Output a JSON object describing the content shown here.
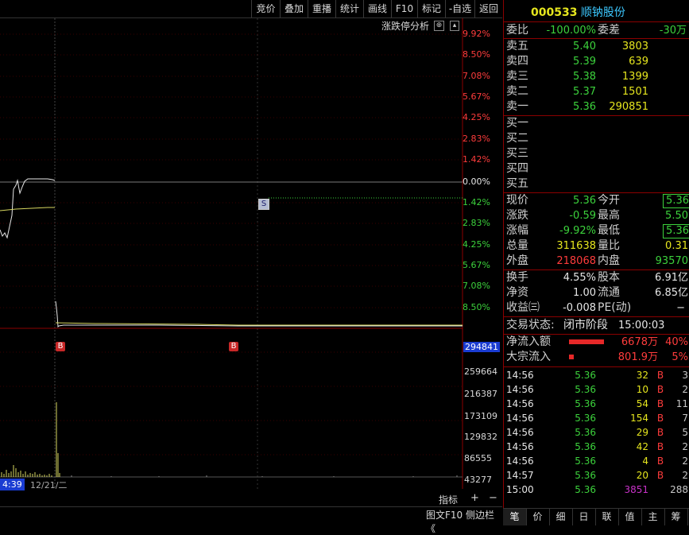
{
  "toolbar": {
    "items": [
      "竞价",
      "叠加",
      "重播",
      "统计",
      "画线",
      "F10",
      "标记",
      "-自选",
      "返回"
    ]
  },
  "chart": {
    "panel_title": "涨跌停分析",
    "pct_labels_up": [
      "9.92%",
      "8.50%",
      "7.08%",
      "5.67%",
      "4.25%",
      "2.83%",
      "1.42%"
    ],
    "pct_zero": "0.00%",
    "pct_labels_down": [
      "1.42%",
      "2.83%",
      "4.25%",
      "5.67%",
      "7.08%",
      "8.50%"
    ],
    "vol_labels": [
      "294841",
      "259664",
      "216387",
      "173109",
      "129832",
      "86555",
      "43277"
    ],
    "time_left": "4:39",
    "date_label": "12/21/二",
    "markers": {
      "s": "S",
      "b": "B"
    },
    "bottom_buttons": {
      "indicator": "指标",
      "plus": "+",
      "minus": "−"
    },
    "footer_right": "图文F10 侧边栏 《"
  },
  "stock": {
    "code": "000533",
    "name": "顺钠股份"
  },
  "weibi": {
    "label": "委比",
    "value": "-100.00%",
    "wc_label": "委差",
    "wc_value": "-30万"
  },
  "sell": [
    {
      "label": "卖五",
      "price": "5.40",
      "vol": "3803"
    },
    {
      "label": "卖四",
      "price": "5.39",
      "vol": "639"
    },
    {
      "label": "卖三",
      "price": "5.38",
      "vol": "1399"
    },
    {
      "label": "卖二",
      "price": "5.37",
      "vol": "1501"
    },
    {
      "label": "卖一",
      "price": "5.36",
      "vol": "290851"
    }
  ],
  "buy": [
    "买一",
    "买二",
    "买三",
    "买四",
    "买五"
  ],
  "quote": [
    {
      "l1": "现价",
      "v1": "5.36",
      "l2": "今开",
      "v2": "5.36"
    },
    {
      "l1": "涨跌",
      "v1": "-0.59",
      "l2": "最高",
      "v2": "5.50"
    },
    {
      "l1": "涨幅",
      "v1": "-9.92%",
      "l2": "最低",
      "v2": "5.36"
    },
    {
      "l1": "总量",
      "v1": "311638",
      "l2": "量比",
      "v2": "0.31"
    },
    {
      "l1": "外盘",
      "v1": "218068",
      "l2": "内盘",
      "v2": "93570"
    }
  ],
  "stats": [
    {
      "l1": "换手",
      "v1": "4.55%",
      "l2": "股本",
      "v2": "6.91亿"
    },
    {
      "l1": "净资",
      "v1": "1.00",
      "l2": "流通",
      "v2": "6.85亿"
    },
    {
      "l1": "收益㈢",
      "v1": "-0.008",
      "l2": "PE(动)",
      "v2": "−"
    }
  ],
  "trade_status": {
    "label": "交易状态:",
    "value": "闭市阶段",
    "time": "15:00:03"
  },
  "flows": [
    {
      "label": "净流入额",
      "value": "6678万",
      "pct": "40%",
      "bar_fraction": 0.4
    },
    {
      "label": "大宗流入",
      "value": "801.9万",
      "pct": "5%",
      "bar_fraction": 0.05
    }
  ],
  "ticks": [
    {
      "time": "14:56",
      "price": "5.36",
      "vol": "32",
      "bs": "B",
      "n": "3"
    },
    {
      "time": "14:56",
      "price": "5.36",
      "vol": "10",
      "bs": "B",
      "n": "2"
    },
    {
      "time": "14:56",
      "price": "5.36",
      "vol": "54",
      "bs": "B",
      "n": "11"
    },
    {
      "time": "14:56",
      "price": "5.36",
      "vol": "154",
      "bs": "B",
      "n": "7"
    },
    {
      "time": "14:56",
      "price": "5.36",
      "vol": "29",
      "bs": "B",
      "n": "5"
    },
    {
      "time": "14:56",
      "price": "5.36",
      "vol": "42",
      "bs": "B",
      "n": "2"
    },
    {
      "time": "14:56",
      "price": "5.36",
      "vol": "4",
      "bs": "B",
      "n": "2"
    },
    {
      "time": "14:57",
      "price": "5.36",
      "vol": "20",
      "bs": "B",
      "n": "2"
    },
    {
      "time": "15:00",
      "price": "5.36",
      "vol": "3851",
      "bs": "",
      "n": "288"
    }
  ],
  "tabs": [
    "笔",
    "价",
    "细",
    "日",
    "联",
    "值",
    "主",
    "筹"
  ],
  "colors": {
    "up": "#ff3c3c",
    "down": "#3cd23c",
    "neutral": "#e6e6e6",
    "accent": "#e6e61e",
    "frame": "#8b0000"
  }
}
